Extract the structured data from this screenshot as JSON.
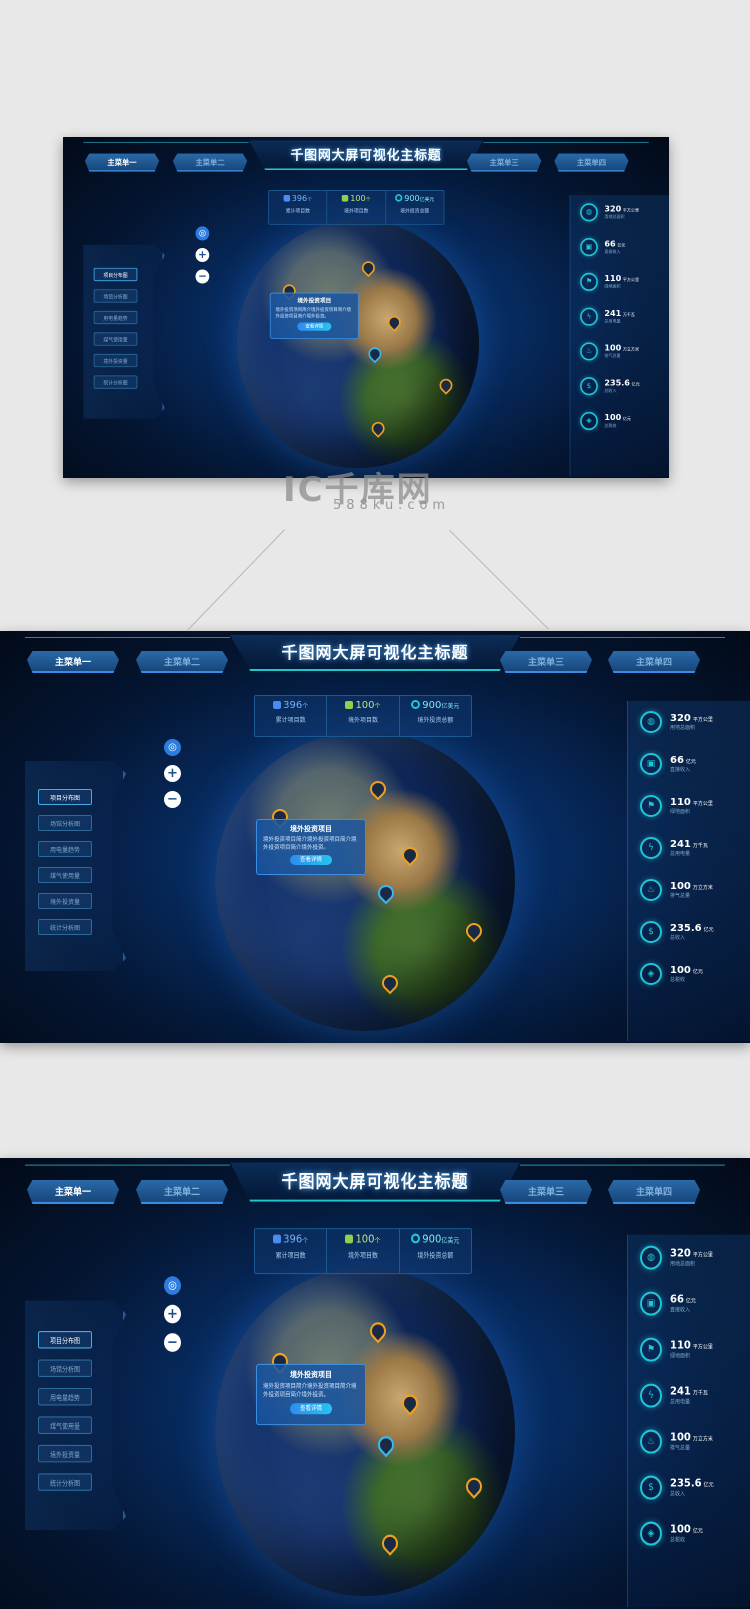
{
  "title": "千图网大屏可视化主标题",
  "menus": [
    {
      "label": "主菜单一",
      "active": true
    },
    {
      "label": "主菜单二",
      "active": false
    },
    {
      "label": "主菜单三",
      "active": false
    },
    {
      "label": "主菜单四",
      "active": false
    }
  ],
  "stats": [
    {
      "icon": "stack-icon",
      "value": "396",
      "unit": "个",
      "label": "累计项目数",
      "color": "#4a8cf0"
    },
    {
      "icon": "database-icon",
      "value": "100",
      "unit": "个",
      "label": "境外项目数",
      "color": "#8fd14f"
    },
    {
      "icon": "ring-icon",
      "value": "900",
      "unit": "亿美元",
      "label": "境外投资总额",
      "color": "#1fc5d8"
    }
  ],
  "map_controls": {
    "locate": "◎",
    "zoom_in": "+",
    "zoom_out": "−"
  },
  "left_menu": [
    {
      "label": "项目分布图",
      "active": true
    },
    {
      "label": "场馆分析图",
      "active": false
    },
    {
      "label": "用电量趋势",
      "active": false
    },
    {
      "label": "煤气使用量",
      "active": false
    },
    {
      "label": "境外投资量",
      "active": false
    },
    {
      "label": "统计分析图",
      "active": false
    }
  ],
  "popup": {
    "title": "境外投资项目",
    "description": "境外投资项目简介境外投资项目简介境外投资项目简介境外投资。",
    "button": "查看详情"
  },
  "metrics": [
    {
      "icon": "globe-icon",
      "glyph": "◍",
      "value": "320",
      "unit": "平方公里",
      "label": "用地总面积"
    },
    {
      "icon": "wallet-icon",
      "glyph": "▣",
      "value": "66",
      "unit": "亿元",
      "label": "直接收入"
    },
    {
      "icon": "tree-icon",
      "glyph": "⚑",
      "value": "110",
      "unit": "平方公里",
      "label": "绿地面积"
    },
    {
      "icon": "lightning-icon",
      "glyph": "ϟ",
      "value": "241",
      "unit": "万千瓦",
      "label": "总用电量"
    },
    {
      "icon": "factory-icon",
      "glyph": "♨",
      "value": "100",
      "unit": "万立方米",
      "label": "排气总量"
    },
    {
      "icon": "money-bag-icon",
      "glyph": "$",
      "value": "235.6",
      "unit": "亿元",
      "label": "总收入"
    },
    {
      "icon": "tag-icon",
      "glyph": "◈",
      "value": "100",
      "unit": "亿元",
      "label": "总税收"
    }
  ],
  "watermark": {
    "brand": "IC千库网",
    "domain": "588ku.com"
  }
}
